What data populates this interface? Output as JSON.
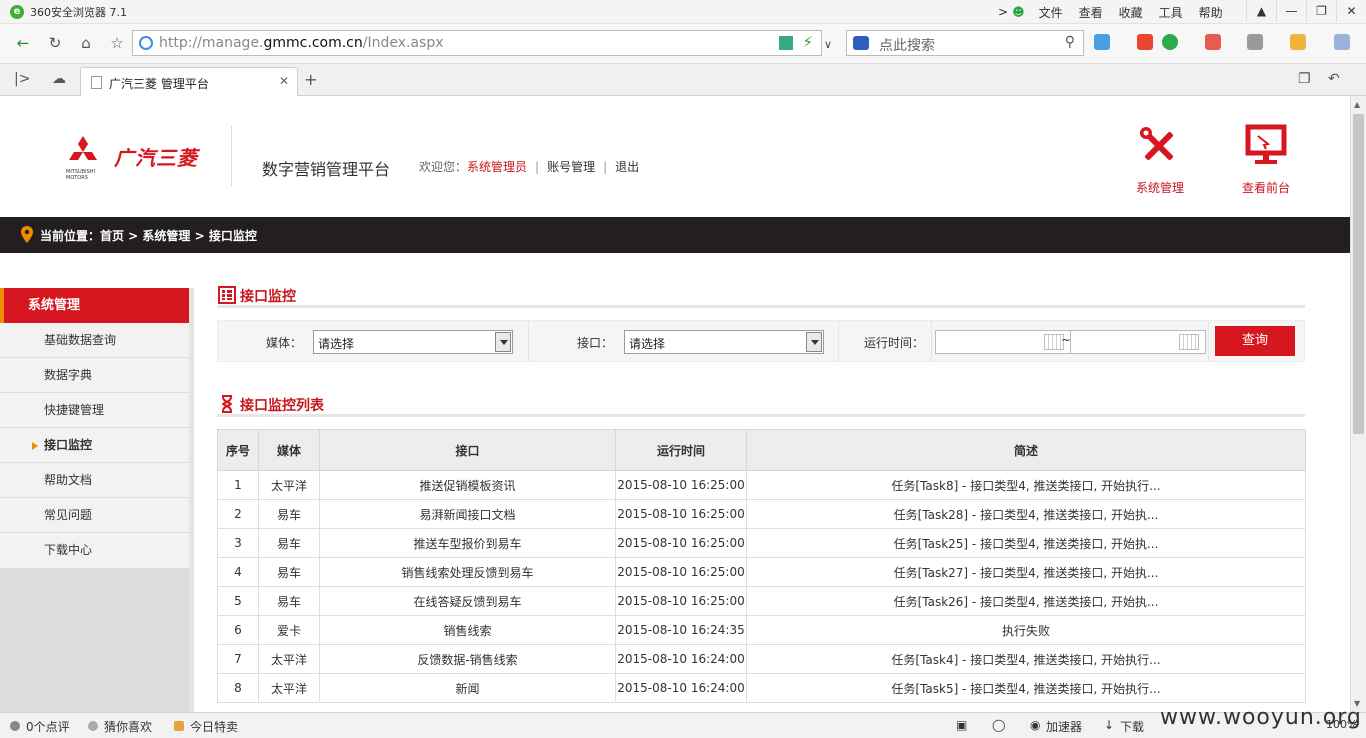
{
  "browser": {
    "title": "360安全浏览器 7.1",
    "menus": [
      "文件",
      "查看",
      "收藏",
      "工具",
      "帮助"
    ],
    "url_prefix": "http://manage.",
    "url_domain": "gmmc.com.cn",
    "url_suffix": "/Index.aspx",
    "search_placeholder": "点此搜索",
    "tab_title": "广汽三菱 管理平台",
    "zoom": "100%"
  },
  "header": {
    "brand": "广汽三菱",
    "mitsubishi_text": "MITSUBISHI MOTORS",
    "platform": "数字营销管理平台",
    "welcome": "欢迎您：",
    "user": "系统管理员",
    "account": "账号管理",
    "logout": "退出",
    "sys_admin": "系统管理",
    "view_front": "查看前台"
  },
  "breadcrumb": "当前位置：首页 > 系统管理 > 接口监控",
  "sidebar": {
    "title": "系统管理",
    "items": [
      {
        "label": "基础数据查询"
      },
      {
        "label": "数据字典"
      },
      {
        "label": "快捷键管理"
      },
      {
        "label": "接口监控"
      },
      {
        "label": "帮助文档"
      },
      {
        "label": "常见问题"
      },
      {
        "label": "下载中心"
      }
    ]
  },
  "main": {
    "section_title": "接口监控",
    "filter": {
      "media_label": "媒体：",
      "media_value": "请选择",
      "api_label": "接口：",
      "api_value": "请选择",
      "time_label": "运行时间：",
      "tilde": "~",
      "query": "查询"
    },
    "list_title": "接口监控列表",
    "columns": [
      "序号",
      "媒体",
      "接口",
      "运行时间",
      "简述"
    ],
    "rows": [
      [
        "1",
        "太平洋",
        "推送促销模板资讯",
        "2015-08-10 16:25:00",
        "任务[Task8] - 接口类型4, 推送类接口, 开始执行..."
      ],
      [
        "2",
        "易车",
        "易湃新闻接口文档",
        "2015-08-10 16:25:00",
        "任务[Task28] - 接口类型4, 推送类接口, 开始执..."
      ],
      [
        "3",
        "易车",
        "推送车型报价到易车",
        "2015-08-10 16:25:00",
        "任务[Task25] - 接口类型4, 推送类接口, 开始执..."
      ],
      [
        "4",
        "易车",
        "销售线索处理反馈到易车",
        "2015-08-10 16:25:00",
        "任务[Task27] - 接口类型4, 推送类接口, 开始执..."
      ],
      [
        "5",
        "易车",
        "在线答疑反馈到易车",
        "2015-08-10 16:25:00",
        "任务[Task26] - 接口类型4, 推送类接口, 开始执..."
      ],
      [
        "6",
        "爱卡",
        "销售线索",
        "2015-08-10 16:24:35",
        "执行失败"
      ],
      [
        "7",
        "太平洋",
        "反馈数据-销售线索",
        "2015-08-10 16:24:00",
        "任务[Task4] - 接口类型4, 推送类接口, 开始执行..."
      ],
      [
        "8",
        "太平洋",
        "新闻",
        "2015-08-10 16:24:00",
        "任务[Task5] - 接口类型4, 推送类接口, 开始执行..."
      ]
    ]
  },
  "statusbar": {
    "comments": "0个点评",
    "guess": "猜你喜欢",
    "deals": "今日特卖",
    "accelerator": "加速器",
    "download": "下载",
    "watermark": "www.wooyun.org"
  },
  "colors": {
    "brand_red": "#d7171f",
    "accent_orange": "#f08c00",
    "crumb_bg": "#231f20"
  }
}
